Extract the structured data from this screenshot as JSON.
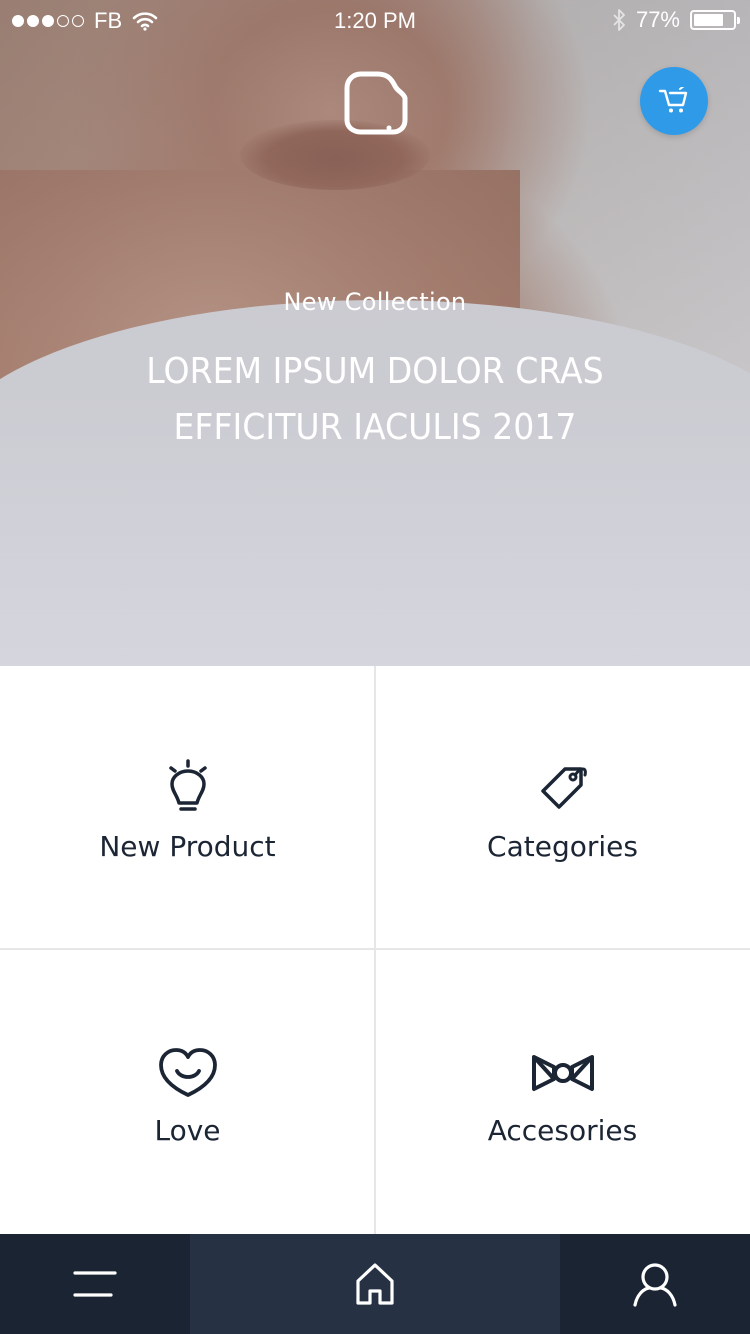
{
  "status_bar": {
    "carrier": "FB",
    "time": "1:20 PM",
    "battery_percent": "77%",
    "battery_level": 0.77,
    "signal_bars_filled": 3,
    "signal_bars_total": 5
  },
  "header": {
    "logo_icon": "app-logo-icon",
    "cart_icon": "cart-icon",
    "cart_color": "#2f9be8"
  },
  "hero": {
    "subtitle": "New Collection",
    "title": "LOREM IPSUM DOLOR CRAS EFFICITUR IACULIS 2017"
  },
  "grid": {
    "items": [
      {
        "label": "New Product",
        "icon": "lightbulb-icon"
      },
      {
        "label": "Categories",
        "icon": "tag-icon"
      },
      {
        "label": "Love",
        "icon": "heart-icon"
      },
      {
        "label": "Accesories",
        "icon": "bowtie-icon"
      }
    ]
  },
  "tab_bar": {
    "items": [
      {
        "icon": "menu-icon",
        "active": false
      },
      {
        "icon": "home-icon",
        "active": true
      },
      {
        "icon": "user-icon",
        "active": false
      }
    ],
    "background": "#1b2433",
    "active_background": "#263244"
  }
}
